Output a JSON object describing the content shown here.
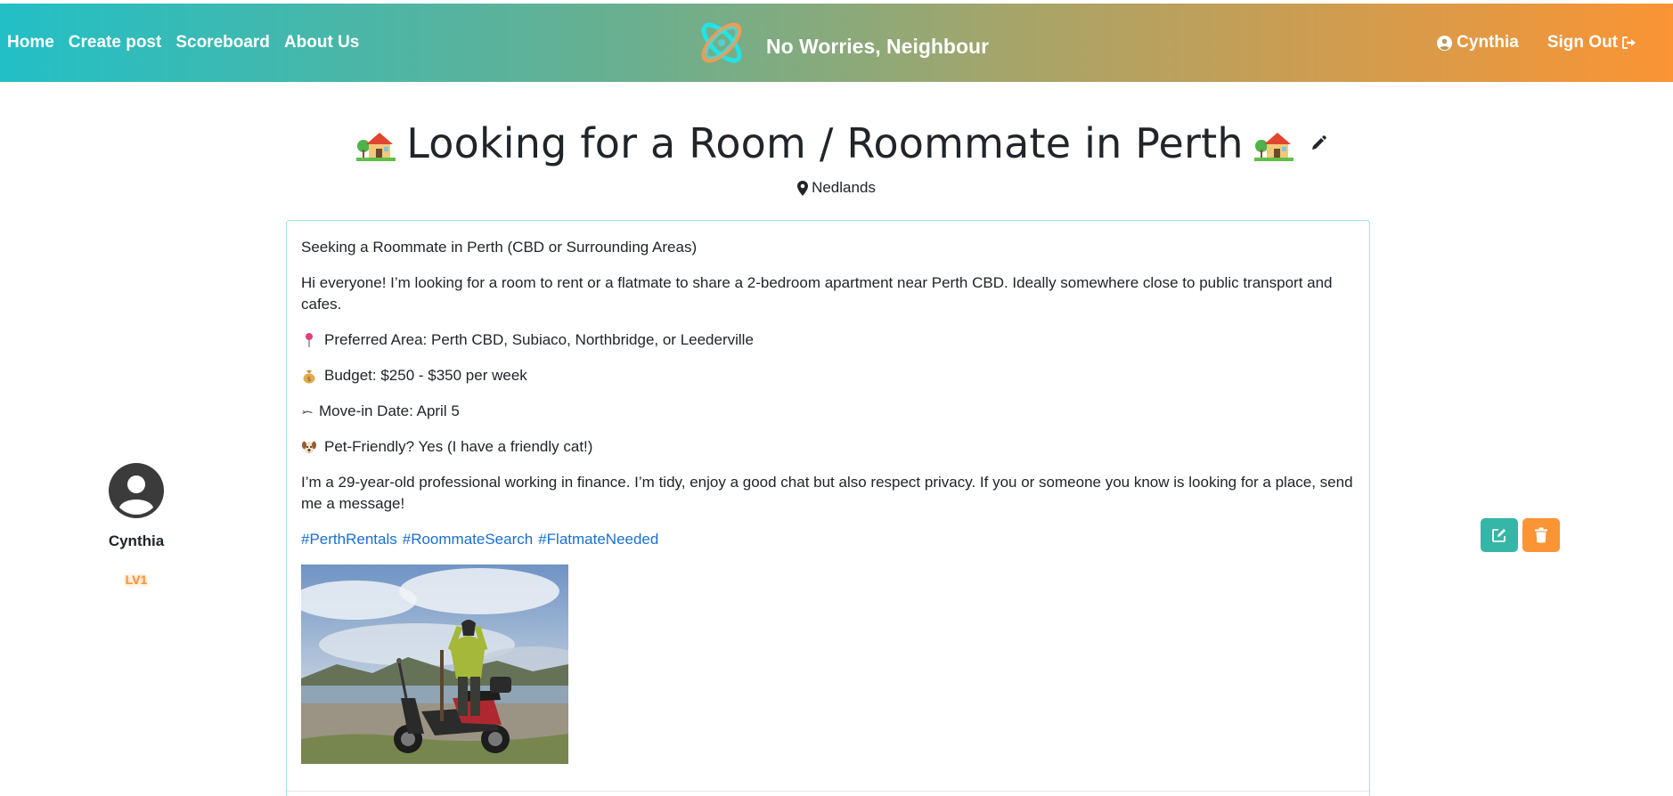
{
  "nav": {
    "links": [
      "Home",
      "Create post",
      "Scoreboard",
      "About Us"
    ],
    "brand": "No Worries, Neighbour",
    "user": "Cynthia",
    "signout": "Sign Out"
  },
  "post": {
    "title": "Looking for a Room / Roommate in Perth",
    "title_emoji": "house-with-garden-icon",
    "location": "Nedlands",
    "paragraphs": [
      "Seeking a Roommate in Perth (CBD or Surrounding Areas)",
      "Hi everyone! I’m looking for a room to rent or a flatmate to share a 2-bedroom apartment near Perth CBD. Ideally somewhere close to public transport and cafes."
    ],
    "details": [
      {
        "icon": "pushpin-icon",
        "text": "Preferred Area: Perth CBD, Subiaco, Northbridge, or Leederville"
      },
      {
        "icon": "money-bag-icon",
        "text": "Budget: $250 - $350 per week"
      },
      {
        "icon": "calendar-icon",
        "text": "Move-in Date: April 5"
      },
      {
        "icon": "dog-icon",
        "text": "Pet-Friendly? Yes (I have a friendly cat!)"
      }
    ],
    "about": "I’m a 29-year-old professional working in finance. I’m tidy, enjoy a good chat but also respect privacy. If you or someone you know is looking for a place, send me a message!",
    "hashtags": [
      "#PerthRentals",
      "#RoommateSearch",
      "#FlatmateNeeded"
    ]
  },
  "author": {
    "name": "Cynthia",
    "level": "LV1"
  },
  "colors": {
    "nav_gradient_start": "#22bfc6",
    "nav_gradient_end": "#fa9434",
    "edit_button": "#36b6a6",
    "delete_button": "#fa9434",
    "hashtag": "#1a6fd1",
    "card_border": "#a9dde8"
  }
}
